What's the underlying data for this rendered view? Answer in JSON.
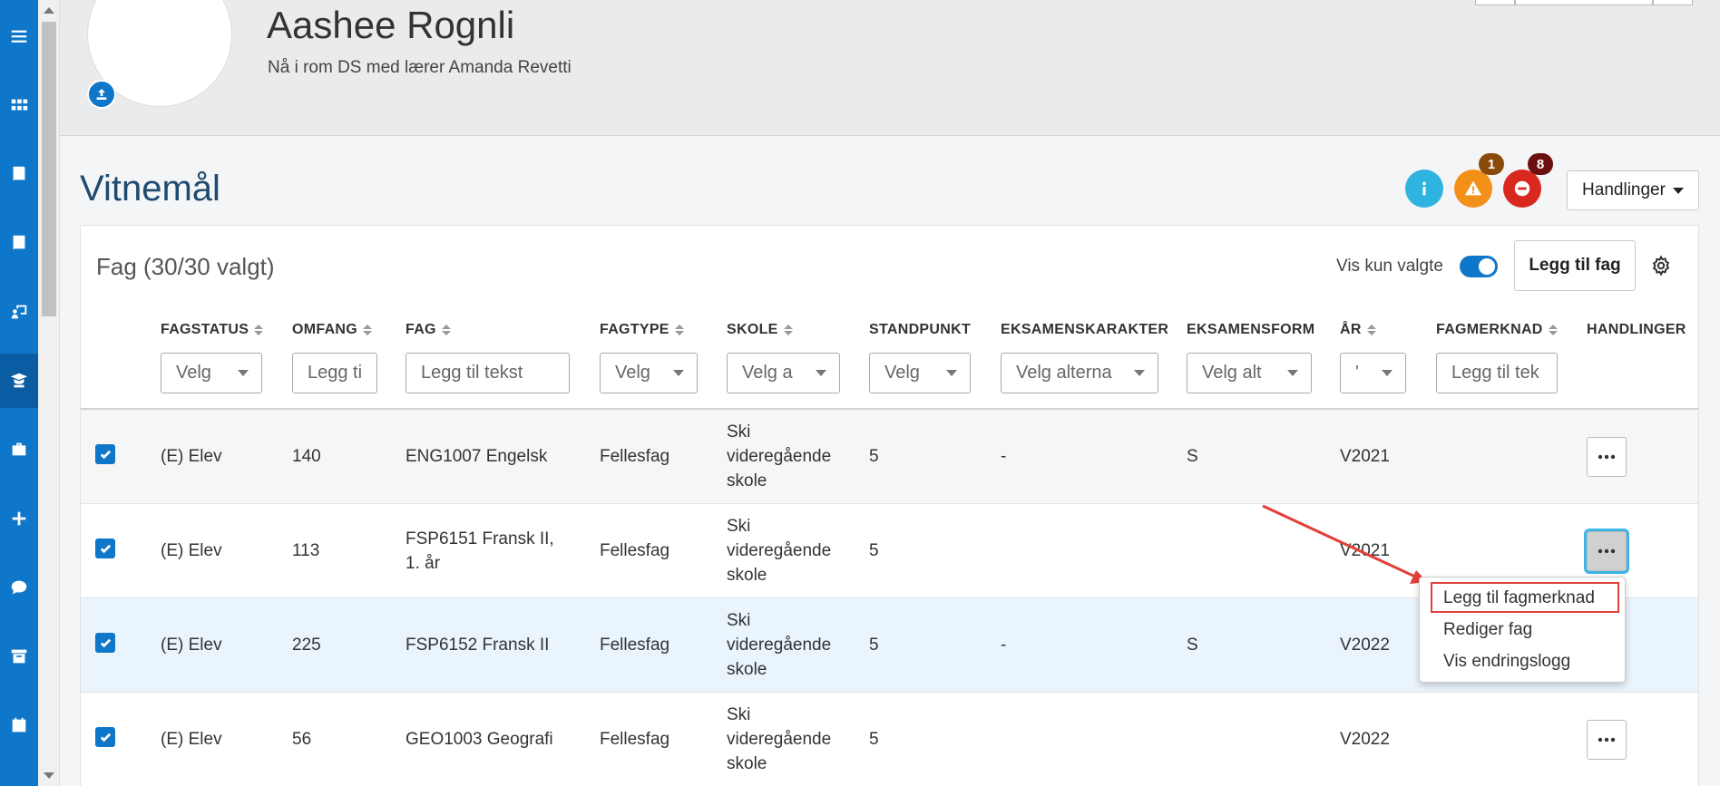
{
  "header": {
    "student_name": "Aashee Rognli",
    "subtitle": "Nå i rom DS med lærer Amanda Revetti"
  },
  "page": {
    "title": "Vitnemål",
    "warning_count": "1",
    "error_count": "8",
    "actions_label": "Handlinger"
  },
  "card": {
    "title": "Fag (30/30 valgt)",
    "toggle_label": "Vis kun valgte",
    "add_button": "Legg til fag"
  },
  "columns": {
    "fagstatus": "FAGSTATUS",
    "omfang": "OMFANG",
    "fag": "FAG",
    "fagtype": "FAGTYPE",
    "skole": "SKOLE",
    "standpunkt": "STANDPUNKT",
    "eksamenskarakter": "EKSAMENSKARAKTER",
    "eksamensform": "EKSAMENSFORM",
    "ar": "ÅR",
    "fagmerknad": "FAGMERKNAD",
    "handlinger": "HANDLINGER"
  },
  "filters": {
    "fagstatus": "Velg",
    "omfang": "Legg ti",
    "fag": "Legg til tekst",
    "fagtype": "Velg",
    "skole": "Velg a",
    "standpunkt": "Velg",
    "eksamenskarakter": "Velg alterna",
    "eksamensform": "Velg alt",
    "ar": "'",
    "fagmerknad": "Legg til tek"
  },
  "rows": [
    {
      "status": "(E) Elev",
      "omfang": "140",
      "fag_l1": "ENG1007 Engelsk",
      "fag_l2": "",
      "fagtype": "Fellesfag",
      "skole_l1": "Ski",
      "skole_l2": "videregående",
      "skole_l3": "skole",
      "standpunkt": "5",
      "eksamenskarakter": "-",
      "eksamensform": "S",
      "ar": "V2021"
    },
    {
      "status": "(E) Elev",
      "omfang": "113",
      "fag_l1": "FSP6151 Fransk II,",
      "fag_l2": "1. år",
      "fagtype": "Fellesfag",
      "skole_l1": "Ski",
      "skole_l2": "videregående",
      "skole_l3": "skole",
      "standpunkt": "5",
      "eksamenskarakter": "",
      "eksamensform": "",
      "ar": "V2021"
    },
    {
      "status": "(E) Elev",
      "omfang": "225",
      "fag_l1": "FSP6152 Fransk II",
      "fag_l2": "",
      "fagtype": "Fellesfag",
      "skole_l1": "Ski",
      "skole_l2": "videregående",
      "skole_l3": "skole",
      "standpunkt": "5",
      "eksamenskarakter": "-",
      "eksamensform": "S",
      "ar": "V2022"
    },
    {
      "status": "(E) Elev",
      "omfang": "56",
      "fag_l1": "GEO1003 Geografi",
      "fag_l2": "",
      "fagtype": "Fellesfag",
      "skole_l1": "Ski",
      "skole_l2": "videregående",
      "skole_l3": "skole",
      "standpunkt": "5",
      "eksamenskarakter": "",
      "eksamensform": "",
      "ar": "V2022"
    }
  ],
  "menu": {
    "item1": "Legg til fagmerknad",
    "item2": "Rediger fag",
    "item3": "Vis endringslogg"
  },
  "colors": {
    "sidebar": "#0f77c9",
    "info": "#2fb4e0",
    "warning": "#f39019",
    "error": "#d9291f",
    "warning_badge": "#8a4a0a",
    "error_badge": "#6b0f0f",
    "annotation": "#e0403a"
  }
}
